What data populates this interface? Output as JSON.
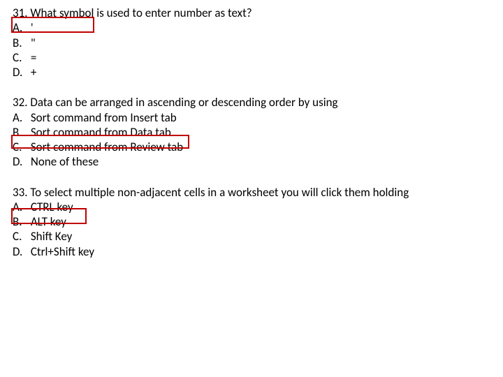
{
  "questions": [
    {
      "number_label": "31.",
      "prompt": "What symbol is used to enter number as text?",
      "options": [
        {
          "label": "A.",
          "text": "'"
        },
        {
          "label": "B.",
          "text": "\""
        },
        {
          "label": "C.",
          "text": "="
        },
        {
          "label": "D.",
          "text": "+"
        }
      ],
      "highlight_index": 0
    },
    {
      "number_label": "32.",
      "prompt": "Data can be arranged in ascending or descending order by using",
      "options": [
        {
          "label": "A.",
          "text": "Sort command from Insert tab"
        },
        {
          "label": "B.",
          "text": "Sort command from Data tab"
        },
        {
          "label": "C.",
          "text": "Sort command from Review tab"
        },
        {
          "label": "D.",
          "text": "None of these"
        }
      ],
      "highlight_index": 1
    },
    {
      "number_label": "33.",
      "prompt": "To select multiple non-adjacent cells in a worksheet you will click them holding",
      "options": [
        {
          "label": "A.",
          "text": "CTRL key"
        },
        {
          "label": "B.",
          "text": "ALT key"
        },
        {
          "label": "C.",
          "text": "Shift Key"
        },
        {
          "label": "D.",
          "text": "Ctrl+Shift key"
        }
      ],
      "highlight_index": 0
    }
  ]
}
